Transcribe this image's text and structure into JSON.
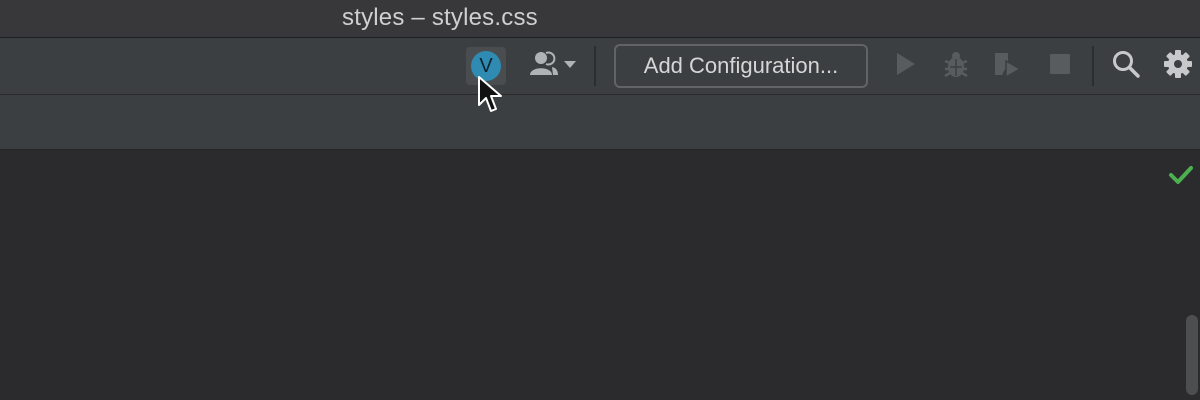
{
  "window": {
    "title": "styles – styles.css"
  },
  "toolbar": {
    "user_avatar": {
      "initial": "V",
      "color": "#2f8bb1"
    },
    "people_icon": "people-dropdown-icon",
    "add_configuration_label": "Add Configuration...",
    "run_icon": "play-icon",
    "debug_icon": "bug-icon",
    "coverage_icon": "run-with-coverage-icon",
    "stop_icon": "stop-icon",
    "search_icon": "search-icon",
    "settings_icon": "gear-icon"
  },
  "editor": {
    "status_icon": "checkmark-icon",
    "status_color": "#4caf50"
  }
}
